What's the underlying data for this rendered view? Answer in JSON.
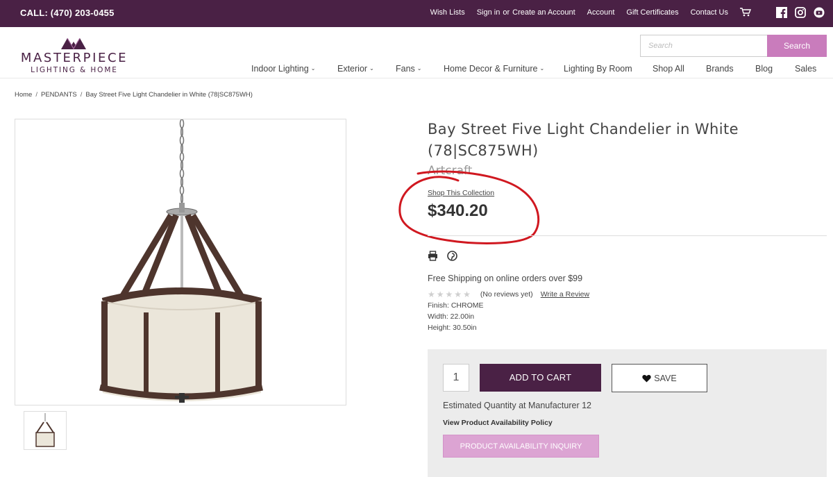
{
  "topbar": {
    "phone": "CALL: (470) 203-0455",
    "links": {
      "wish_lists": "Wish Lists",
      "sign_in": "Sign in",
      "or": "or",
      "create_account": "Create an Account",
      "account": "Account",
      "gift_certificates": "Gift Certificates",
      "contact_us": "Contact Us"
    },
    "icons": [
      "cart-icon",
      "facebook-icon",
      "instagram-icon",
      "youtube-icon"
    ]
  },
  "header": {
    "logo_name": "MASTERPIECE",
    "logo_sub": "LIGHTING & HOME",
    "search_placeholder": "Search",
    "search_button": "Search"
  },
  "nav": {
    "indoor": "Indoor Lighting",
    "exterior": "Exterior",
    "fans": "Fans",
    "home_decor": "Home Decor & Furniture",
    "by_room": "Lighting By Room",
    "shop_all": "Shop All",
    "brands": "Brands",
    "blog": "Blog",
    "sales": "Sales"
  },
  "breadcrumb": {
    "home": "Home",
    "category": "PENDANTS",
    "current": "Bay Street Five Light Chandelier in White (78|SC875WH)",
    "separator": "/"
  },
  "product": {
    "title_line1": "Bay Street Five Light Chandelier in White",
    "title_line2": "(78|SC875WH)",
    "brand": "Artcraft",
    "collection_link": "Shop This Collection",
    "price": "$340.20",
    "shipping": "Free Shipping on online orders over $99",
    "rating_stars": 0,
    "reviews": "(No reviews yet)",
    "write_review": "Write a Review",
    "finish": "Finish: CHROME",
    "width": "Width: 22.00in",
    "height": "Height: 30.50in"
  },
  "cart": {
    "quantity": "1",
    "add_to_cart": "ADD TO CART",
    "save": "SAVE",
    "estimated_quantity": "Estimated Quantity at Manufacturer 12",
    "availability_policy": "View Product Availability Policy",
    "availability_inquiry": "PRODUCT AVAILABILITY INQUIRY"
  },
  "colors": {
    "brand_purple": "#4a2145",
    "accent_pink": "#c97cbc",
    "inquiry_pink": "#dca4d3",
    "annotation_red": "#d01820"
  }
}
